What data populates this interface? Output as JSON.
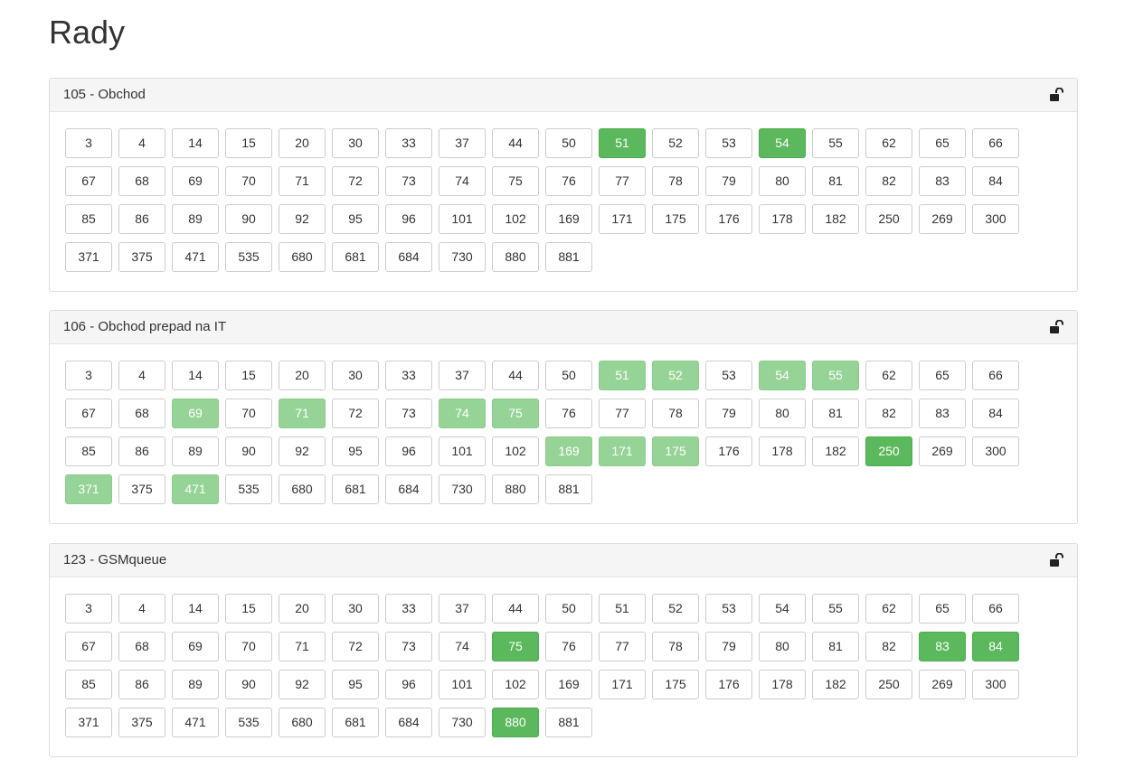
{
  "page": {
    "title": "Rady"
  },
  "colors": {
    "active": "#5cb85c",
    "partial": "#96d396",
    "default": "#ffffff"
  },
  "numbers": [
    "3",
    "4",
    "14",
    "15",
    "20",
    "30",
    "33",
    "37",
    "44",
    "50",
    "51",
    "52",
    "53",
    "54",
    "55",
    "62",
    "65",
    "66",
    "67",
    "68",
    "69",
    "70",
    "71",
    "72",
    "73",
    "74",
    "75",
    "76",
    "77",
    "78",
    "79",
    "80",
    "81",
    "82",
    "83",
    "84",
    "85",
    "86",
    "89",
    "90",
    "92",
    "95",
    "96",
    "101",
    "102",
    "169",
    "171",
    "175",
    "176",
    "178",
    "182",
    "250",
    "269",
    "300",
    "371",
    "375",
    "471",
    "535",
    "680",
    "681",
    "684",
    "730",
    "880",
    "881"
  ],
  "panels": [
    {
      "title": "105 - Obchod",
      "icon": "unlock-icon",
      "active": [
        "51",
        "54"
      ],
      "partial": []
    },
    {
      "title": "106 - Obchod prepad na IT",
      "icon": "unlock-icon",
      "active": [
        "250"
      ],
      "partial": [
        "51",
        "52",
        "54",
        "55",
        "69",
        "71",
        "74",
        "75",
        "169",
        "171",
        "175",
        "371",
        "471"
      ]
    },
    {
      "title": "123 - GSMqueue",
      "icon": "unlock-icon",
      "active": [
        "75",
        "83",
        "84",
        "880"
      ],
      "partial": []
    }
  ]
}
